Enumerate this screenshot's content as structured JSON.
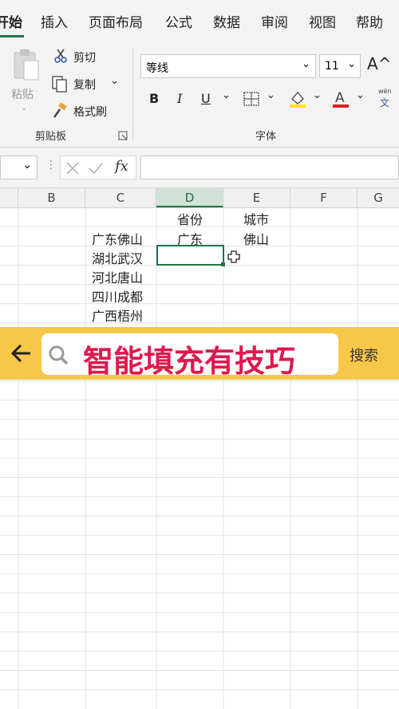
{
  "ribbon_tabs": [
    "开始",
    "插入",
    "页面布局",
    "公式",
    "数据",
    "审阅",
    "视图",
    "帮助"
  ],
  "active_tab": "开始",
  "clipboard": {
    "paste": "粘贴",
    "cut": "剪切",
    "copy": "复制",
    "format_painter": "格式刷",
    "group_label": "剪贴板"
  },
  "font": {
    "name": "等线",
    "size": "11",
    "bold": "B",
    "italic": "I",
    "underline": "U",
    "grow": "A^",
    "wen": "wén",
    "wen_char": "文",
    "group_label": "字体"
  },
  "formula_bar": {
    "name_box": "",
    "fx": "fx",
    "value": ""
  },
  "columns": [
    "B",
    "C",
    "D",
    "E",
    "F",
    "G"
  ],
  "selected_column": "D",
  "selected_cell": "D3",
  "cells": {
    "d1": "省份",
    "e1": "城市",
    "c2": "广东佛山",
    "d2": "广东",
    "e2": "佛山",
    "c3": "湖北武汉",
    "c4": "河北唐山",
    "c5": "四川成都",
    "c6": "广西梧州"
  },
  "search_banner": {
    "query": "智能填充有技巧",
    "button": "搜索",
    "accent": "#f7c747",
    "text_color": "#e0184f"
  },
  "colors": {
    "excel_green": "#217346"
  }
}
